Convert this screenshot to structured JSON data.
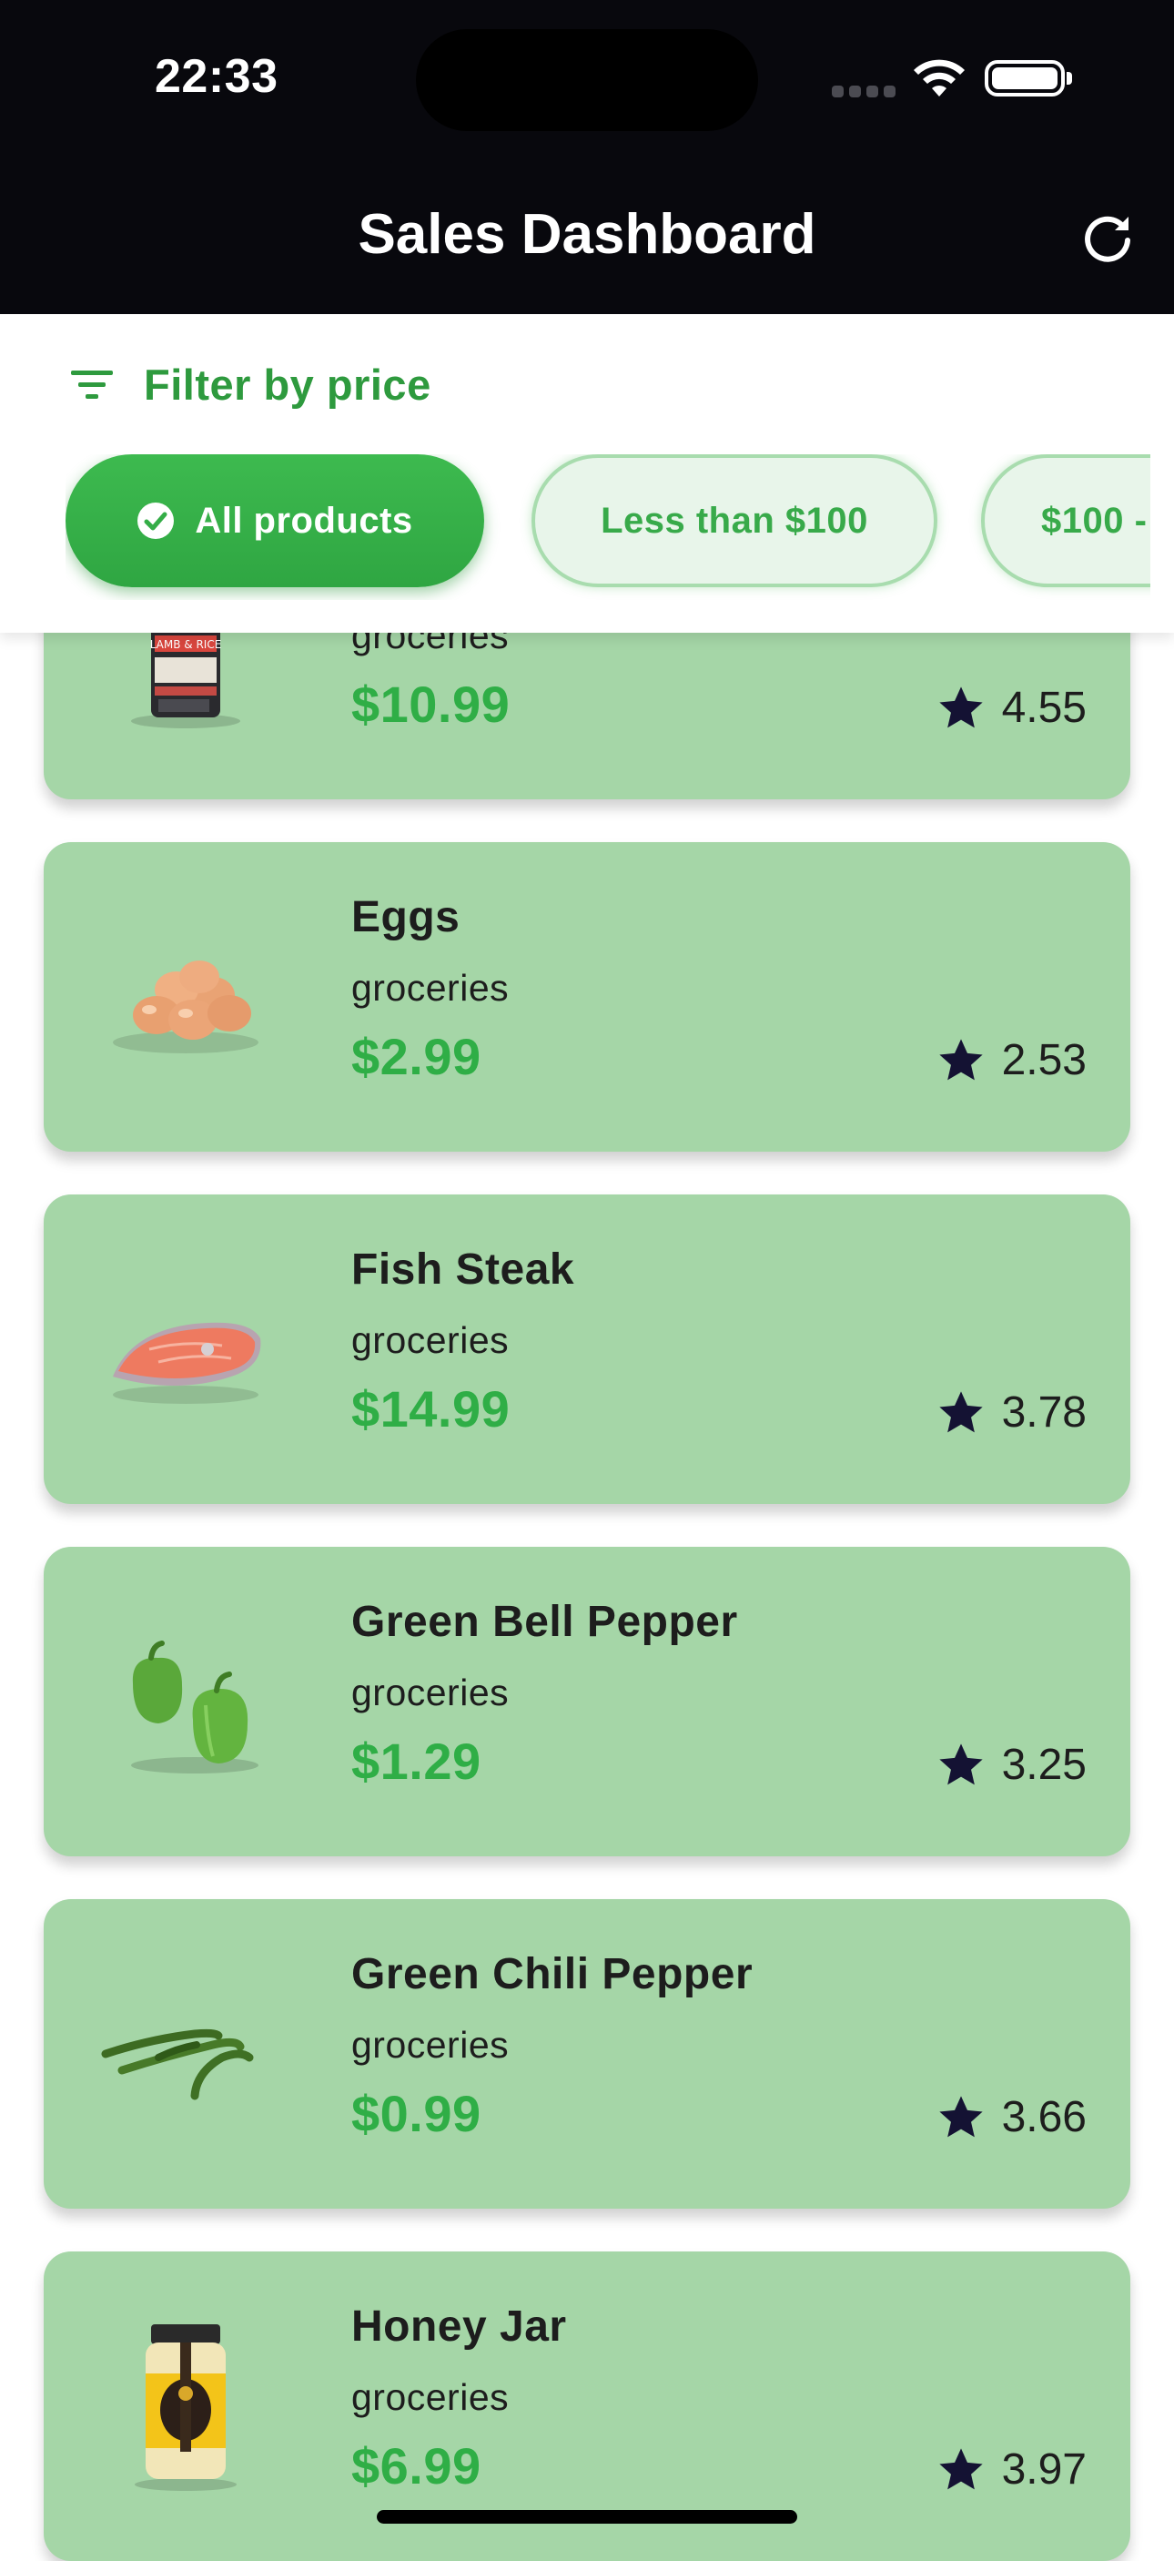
{
  "status_bar": {
    "time": "22:33"
  },
  "app_bar": {
    "title": "Sales Dashboard",
    "refresh_icon": "refresh-icon"
  },
  "filter": {
    "label": "Filter by price",
    "icon": "filter-icon",
    "chips": [
      {
        "label": "All products",
        "selected": true
      },
      {
        "label": "Less than $100",
        "selected": false
      },
      {
        "label": "$100 -",
        "selected": false
      }
    ]
  },
  "products": [
    {
      "name": "",
      "category": "groceries",
      "price": "$10.99",
      "rating": "4.55",
      "image": "dog-food-bag"
    },
    {
      "name": "Eggs",
      "category": "groceries",
      "price": "$2.99",
      "rating": "2.53",
      "image": "eggs"
    },
    {
      "name": "Fish Steak",
      "category": "groceries",
      "price": "$14.99",
      "rating": "3.78",
      "image": "fish-steak"
    },
    {
      "name": "Green Bell Pepper",
      "category": "groceries",
      "price": "$1.29",
      "rating": "3.25",
      "image": "green-bell-pepper"
    },
    {
      "name": "Green Chili Pepper",
      "category": "groceries",
      "price": "$0.99",
      "rating": "3.66",
      "image": "green-chili-pepper"
    },
    {
      "name": "Honey Jar",
      "category": "groceries",
      "price": "$6.99",
      "rating": "3.97",
      "image": "honey-jar"
    }
  ],
  "colors": {
    "app_bar_bg": "#08080d",
    "card_bg": "#a5d6a7",
    "accent_green": "#2fae46",
    "star": "#141233"
  }
}
